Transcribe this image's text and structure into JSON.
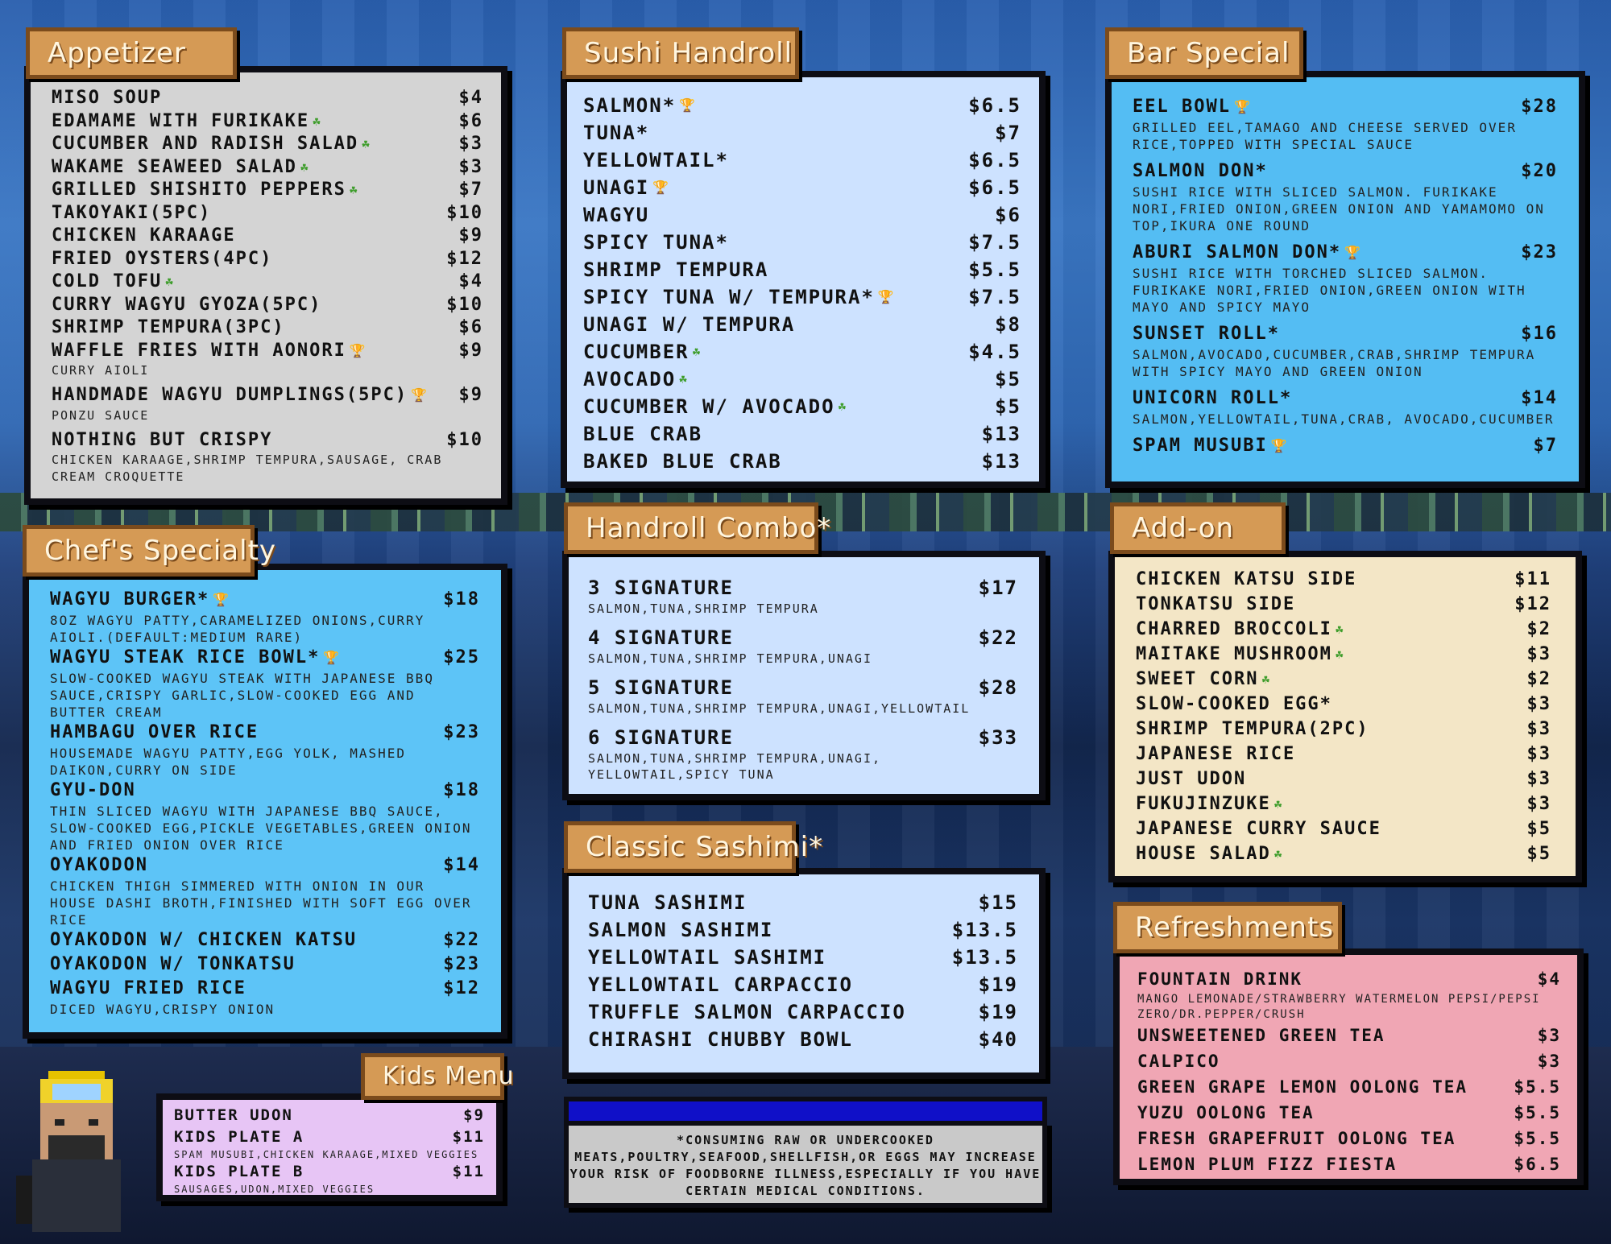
{
  "appetizer": {
    "title": "Appetizer",
    "items": [
      {
        "name": "MISO SOUP",
        "price": "$4",
        "icon": ""
      },
      {
        "name": "EDAMAME WITH FURIKAKE",
        "price": "$6",
        "icon": "vegan-icon"
      },
      {
        "name": "CUCUMBER AND RADISH SALAD",
        "price": "$3",
        "icon": "vegan-icon"
      },
      {
        "name": "WAKAME SEAWEED SALAD",
        "price": "$3",
        "icon": "vegan-icon"
      },
      {
        "name": "GRILLED SHISHITO PEPPERS",
        "price": "$7",
        "icon": "vegan-icon"
      },
      {
        "name": "TAKOYAKI(5PC)",
        "price": "$10",
        "icon": ""
      },
      {
        "name": "CHICKEN KARAAGE",
        "price": "$9",
        "icon": ""
      },
      {
        "name": "FRIED OYSTERS(4PC)",
        "price": "$12",
        "icon": ""
      },
      {
        "name": "COLD TOFU",
        "price": "$4",
        "icon": "vegan-icon"
      },
      {
        "name": "CURRY WAGYU GYOZA(5PC)",
        "price": "$10",
        "icon": ""
      },
      {
        "name": "SHRIMP TEMPURA(3PC)",
        "price": "$6",
        "icon": ""
      },
      {
        "name": "WAFFLE FRIES WITH AONORI",
        "price": "$9",
        "icon": "trophy-icon",
        "desc": "CURRY AIOLI"
      },
      {
        "name": "HANDMADE WAGYU DUMPLINGS(5PC)",
        "price": "$9",
        "icon": "trophy-icon",
        "desc": "PONZU SAUCE"
      },
      {
        "name": "NOTHING BUT CRISPY",
        "price": "$10",
        "icon": "",
        "desc": "CHICKEN KARAAGE,SHRIMP TEMPURA,SAUSAGE, CRAB CREAM CROQUETTE"
      }
    ]
  },
  "handroll": {
    "title": "Sushi Handroll",
    "items": [
      {
        "name": "SALMON*",
        "price": "$6.5",
        "icon": "trophy-icon"
      },
      {
        "name": "TUNA*",
        "price": "$7",
        "icon": ""
      },
      {
        "name": "YELLOWTAIL*",
        "price": "$6.5",
        "icon": ""
      },
      {
        "name": "UNAGI",
        "price": "$6.5",
        "icon": "trophy-icon"
      },
      {
        "name": "WAGYU",
        "price": "$6",
        "icon": ""
      },
      {
        "name": "SPICY TUNA*",
        "price": "$7.5",
        "icon": ""
      },
      {
        "name": "SHRIMP TEMPURA",
        "price": "$5.5",
        "icon": ""
      },
      {
        "name": "SPICY TUNA W/ TEMPURA*",
        "price": "$7.5",
        "icon": "trophy-icon"
      },
      {
        "name": "UNAGI W/ TEMPURA",
        "price": "$8",
        "icon": ""
      },
      {
        "name": "CUCUMBER",
        "price": "$4.5",
        "icon": "vegan-icon"
      },
      {
        "name": "AVOCADO",
        "price": "$5",
        "icon": "vegan-icon"
      },
      {
        "name": "CUCUMBER W/ AVOCADO",
        "price": "$5",
        "icon": "vegan-icon"
      },
      {
        "name": "BLUE CRAB",
        "price": "$13",
        "icon": ""
      },
      {
        "name": "BAKED BLUE CRAB",
        "price": "$13",
        "icon": ""
      }
    ]
  },
  "bar": {
    "title": "Bar Special",
    "items": [
      {
        "name": "EEL BOWL",
        "price": "$28",
        "icon": "trophy-icon",
        "desc": "GRILLED EEL,TAMAGO AND CHEESE SERVED OVER RICE,TOPPED WITH SPECIAL SAUCE"
      },
      {
        "name": "SALMON DON*",
        "price": "$20",
        "icon": "",
        "desc": "SUSHI RICE WITH SLICED SALMON. FURIKAKE NORI,FRIED ONION,GREEN ONION AND YAMAMOMO ON TOP,IKURA ONE ROUND"
      },
      {
        "name": "ABURI SALMON DON*",
        "price": "$23",
        "icon": "trophy-icon",
        "desc": "SUSHI RICE WITH TORCHED SLICED SALMON. FURIKAKE NORI,FRIED ONION,GREEN ONION WITH MAYO AND SPICY MAYO"
      },
      {
        "name": "SUNSET ROLL*",
        "price": "$16",
        "icon": "",
        "desc": "SALMON,AVOCADO,CUCUMBER,CRAB,SHRIMP TEMPURA WITH SPICY MAYO AND GREEN ONION"
      },
      {
        "name": "UNICORN ROLL*",
        "price": "$14",
        "icon": "",
        "desc": "SALMON,YELLOWTAIL,TUNA,CRAB, AVOCADO,CUCUMBER"
      },
      {
        "name": "SPAM MUSUBI",
        "price": "$7",
        "icon": "trophy-icon"
      }
    ]
  },
  "chef": {
    "title": "Chef's Specialty",
    "items": [
      {
        "name": "WAGYU BURGER*",
        "price": "$18",
        "icon": "trophy-icon",
        "desc": "8OZ WAGYU PATTY,CARAMELIZED ONIONS,CURRY AIOLI.(DEFAULT:MEDIUM RARE)"
      },
      {
        "name": "WAGYU STEAK RICE BOWL*",
        "price": "$25",
        "icon": "trophy-icon",
        "desc": "SLOW-COOKED WAGYU STEAK WITH JAPANESE BBQ SAUCE,CRISPY GARLIC,SLOW-COOKED EGG AND BUTTER CREAM"
      },
      {
        "name": "HAMBAGU OVER RICE",
        "price": "$23",
        "icon": "",
        "desc": "HOUSEMADE WAGYU PATTY,EGG YOLK, MASHED DAIKON,CURRY ON SIDE"
      },
      {
        "name": "GYU-DON",
        "price": "$18",
        "icon": "",
        "desc": "THIN SLICED WAGYU WITH JAPANESE BBQ SAUCE, SLOW-COOKED EGG,PICKLE VEGETABLES,GREEN ONION AND FRIED ONION OVER RICE"
      },
      {
        "name": "OYAKODON",
        "price": "$14",
        "icon": "",
        "desc": "CHICKEN THIGH SIMMERED WITH ONION IN OUR HOUSE DASHI BROTH,FINISHED WITH SOFT EGG OVER RICE"
      },
      {
        "name": "OYAKODON W/ CHICKEN KATSU",
        "price": "$22",
        "icon": ""
      },
      {
        "name": "OYAKODON W/ TONKATSU",
        "price": "$23",
        "icon": ""
      },
      {
        "name": "WAGYU FRIED RICE",
        "price": "$12",
        "icon": "",
        "desc": "DICED WAGYU,CRISPY ONION"
      }
    ]
  },
  "combo": {
    "title": "Handroll Combo*",
    "items": [
      {
        "name": "3 SIGNATURE",
        "price": "$17",
        "desc": "SALMON,TUNA,SHRIMP TEMPURA"
      },
      {
        "name": "4 SIGNATURE",
        "price": "$22",
        "desc": "SALMON,TUNA,SHRIMP TEMPURA,UNAGI"
      },
      {
        "name": "5 SIGNATURE",
        "price": "$28",
        "desc": "SALMON,TUNA,SHRIMP TEMPURA,UNAGI,YELLOWTAIL"
      },
      {
        "name": "6 SIGNATURE",
        "price": "$33",
        "desc": "SALMON,TUNA,SHRIMP TEMPURA,UNAGI, YELLOWTAIL,SPICY TUNA"
      }
    ]
  },
  "addon": {
    "title": "Add-on",
    "items": [
      {
        "name": "CHICKEN KATSU SIDE",
        "price": "$11",
        "icon": ""
      },
      {
        "name": "TONKATSU SIDE",
        "price": "$12",
        "icon": ""
      },
      {
        "name": "CHARRED BROCCOLI",
        "price": "$2",
        "icon": "vegan-icon"
      },
      {
        "name": "MAITAKE MUSHROOM",
        "price": "$3",
        "icon": "vegan-icon"
      },
      {
        "name": "SWEET CORN",
        "price": "$2",
        "icon": "vegan-icon"
      },
      {
        "name": "SLOW-COOKED EGG*",
        "price": "$3",
        "icon": ""
      },
      {
        "name": "SHRIMP TEMPURA(2PC)",
        "price": "$3",
        "icon": ""
      },
      {
        "name": "JAPANESE RICE",
        "price": "$3",
        "icon": ""
      },
      {
        "name": "JUST UDON",
        "price": "$3",
        "icon": ""
      },
      {
        "name": "FUKUJINZUKE",
        "price": "$3",
        "icon": "vegan-icon"
      },
      {
        "name": "JAPANESE CURRY SAUCE",
        "price": "$5",
        "icon": ""
      },
      {
        "name": "HOUSE SALAD",
        "price": "$5",
        "icon": "vegan-icon"
      }
    ]
  },
  "sashimi": {
    "title": "Classic Sashimi*",
    "items": [
      {
        "name": "TUNA SASHIMI",
        "price": "$15"
      },
      {
        "name": "SALMON SASHIMI",
        "price": "$13.5"
      },
      {
        "name": "YELLOWTAIL SASHIMI",
        "price": "$13.5"
      },
      {
        "name": "YELLOWTAIL CARPACCIO",
        "price": "$19"
      },
      {
        "name": "TRUFFLE SALMON CARPACCIO",
        "price": "$19"
      },
      {
        "name": "CHIRASHI CHUBBY BOWL",
        "price": "$40"
      }
    ]
  },
  "refresh": {
    "title": "Refreshments",
    "items": [
      {
        "name": "FOUNTAIN DRINK",
        "price": "$4",
        "desc": "MANGO LEMONADE/STRAWBERRY WATERMELON PEPSI/PEPSI ZERO/DR.PEPPER/CRUSH"
      },
      {
        "name": "UNSWEETENED GREEN TEA",
        "price": "$3"
      },
      {
        "name": "CALPICO",
        "price": "$3"
      },
      {
        "name": "GREEN GRAPE LEMON OOLONG TEA",
        "price": "$5.5"
      },
      {
        "name": "YUZU OOLONG TEA",
        "price": "$5.5"
      },
      {
        "name": "FRESH GRAPEFRUIT OOLONG TEA",
        "price": "$5.5"
      },
      {
        "name": "LEMON PLUM FIZZ FIESTA",
        "price": "$6.5"
      }
    ]
  },
  "kids": {
    "title": "Kids Menu",
    "items": [
      {
        "name": "BUTTER UDON",
        "price": "$9"
      },
      {
        "name": "KIDS PLATE A",
        "price": "$11",
        "desc": "SPAM MUSUBI,CHICKEN KARAAGE,MIXED VEGGIES"
      },
      {
        "name": "KIDS PLATE B",
        "price": "$11",
        "desc": "SAUSAGES,UDON,MIXED VEGGIES"
      }
    ]
  },
  "disclaimer": "*CONSUMING RAW OR UNDERCOOKED MEATS,POULTRY,SEAFOOD,SHELLFISH,OR EGGS MAY INCREASE YOUR RISK OF FOODBORNE ILLNESS,ESPECIALLY IF YOU HAVE CERTAIN MEDICAL CONDITIONS.",
  "colors": {
    "appetizer_bg": "#d4d4d4",
    "handroll_bg": "#cde2ff",
    "bar_bg": "#54bdf3",
    "chef_bg": "#5dc4f7",
    "combo_bg": "#cde2ff",
    "addon_bg": "#f3e6c6",
    "sashimi_bg": "#cde2ff",
    "refresh_bg": "#f0a6b4",
    "kids_bg": "#e7c5f5",
    "tab": "#d59a55"
  }
}
